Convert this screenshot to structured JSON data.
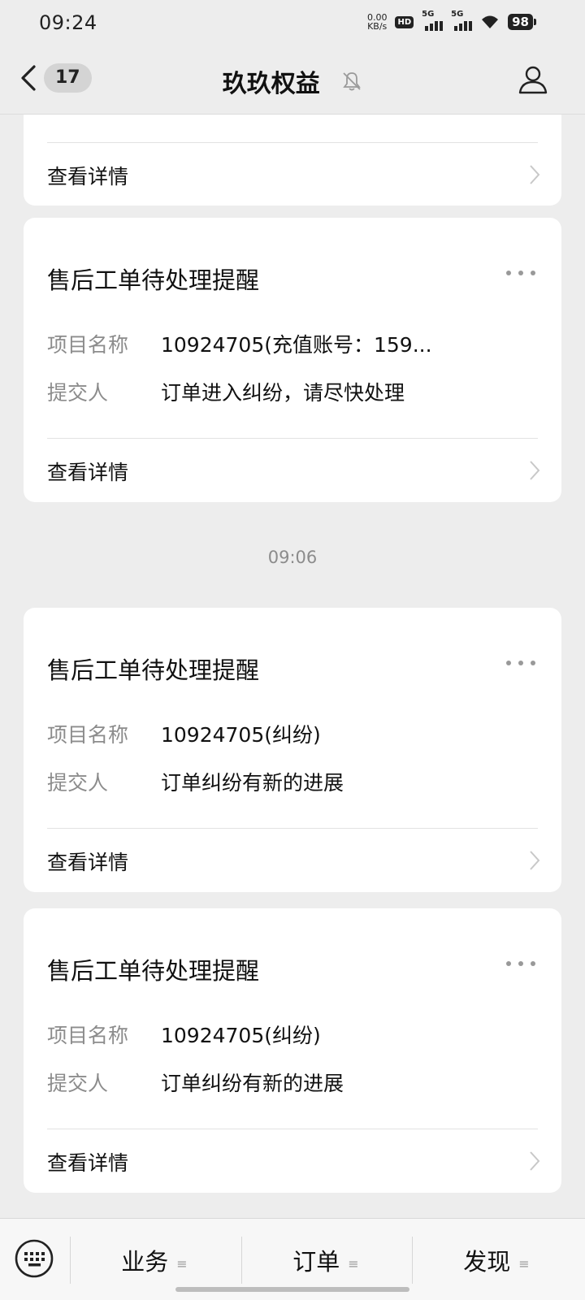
{
  "status_bar": {
    "time": "09:24",
    "net_speed_value": "0.00",
    "net_speed_unit": "KB/s",
    "hd_label": "HD",
    "sim1_label": "5G",
    "sim2_label": "5G",
    "battery": "98"
  },
  "nav": {
    "unread_count": "17",
    "title": "玖玖权益",
    "icons": {
      "back": "chevron-left-icon",
      "mute": "bell-muted-icon",
      "profile": "person-icon"
    }
  },
  "cards": [
    {
      "title": "",
      "fields": [],
      "detail_label": "查看详情"
    },
    {
      "title": "售后工单待处理提醒",
      "fields": [
        {
          "label": "项目名称",
          "value": "10924705(充值账号：159..."
        },
        {
          "label": "提交人",
          "value": "订单进入纠纷，请尽快处理"
        }
      ],
      "detail_label": "查看详情"
    },
    {
      "title": "售后工单待处理提醒",
      "fields": [
        {
          "label": "项目名称",
          "value": "10924705(纠纷)"
        },
        {
          "label": "提交人",
          "value": "订单纠纷有新的进展"
        }
      ],
      "detail_label": "查看详情"
    },
    {
      "title": "售后工单待处理提醒",
      "fields": [
        {
          "label": "项目名称",
          "value": "10924705(纠纷)"
        },
        {
          "label": "提交人",
          "value": "订单纠纷有新的进展"
        }
      ],
      "detail_label": "查看详情"
    }
  ],
  "timestamp": "09:06",
  "bottom_menu": {
    "items": [
      {
        "label": "业务"
      },
      {
        "label": "订单"
      },
      {
        "label": "发现"
      }
    ],
    "menu_icon": "≡",
    "keyboard_icon": "keyboard-icon"
  },
  "colors": {
    "background": "#ededed",
    "card": "#ffffff",
    "muted_text": "#8c8c8c"
  }
}
